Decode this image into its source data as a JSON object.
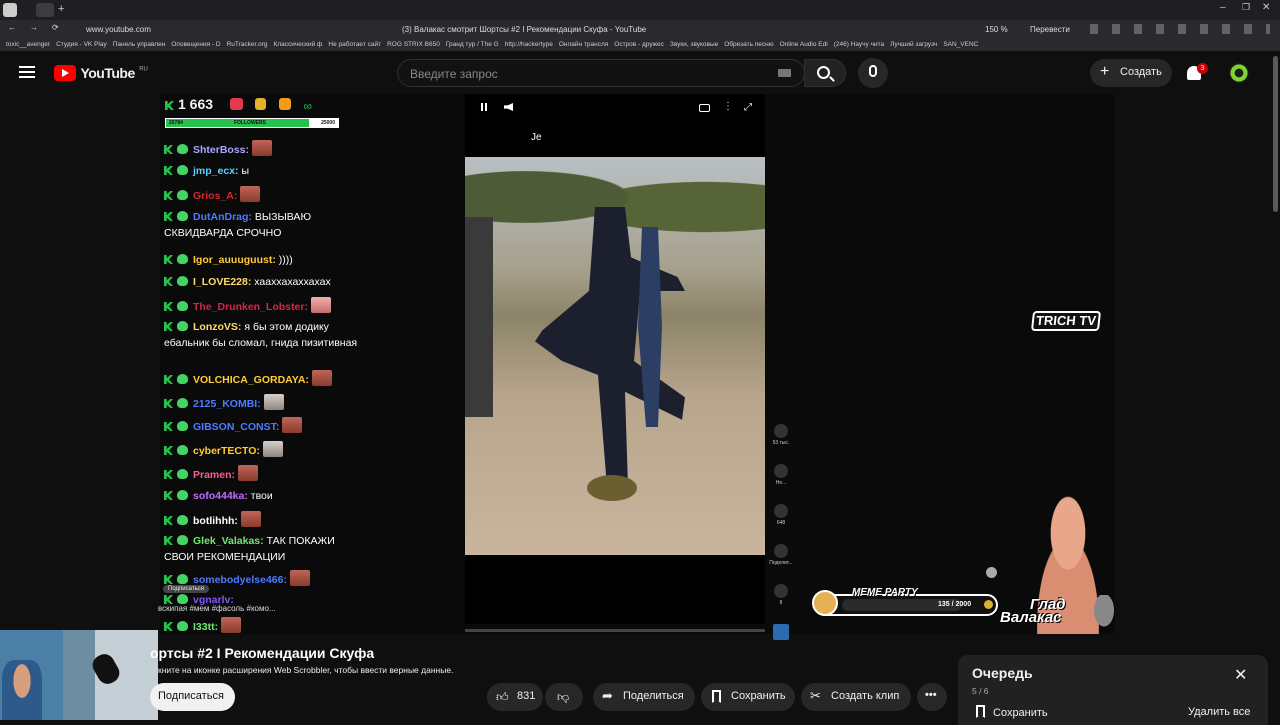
{
  "browser": {
    "url": "www.youtube.com",
    "tab_title": "(3) Валакас смотрит Шортсы #2 I Рекомендации Скуфа - YouTube",
    "zoom": "150 %",
    "translate_label": "Перевести",
    "bookmarks": [
      "toxic__avenger",
      "Студия - VK Play",
      "Панель управлен",
      "Оповещения - D",
      "RuTracker.org",
      "Классический ф",
      "Не работает сайт",
      "ROG STRIX B650",
      "Гранд тур / The G",
      "http://hackertype",
      "Онлайн трансля",
      "Остров - дружес",
      "Звуки, звуковые",
      "Обрезать песню",
      "Online Audio Edi",
      "(246) Научу чита",
      "Лучший загрузч",
      "SAN_VENC"
    ]
  },
  "youtube": {
    "logo_text": "YouTube",
    "region": "RU",
    "search_placeholder": "Введите запрос",
    "create_label": "Создать",
    "notif_count": "3"
  },
  "stream": {
    "follow_count": "1 663",
    "follow_count_shadow": "1 663",
    "followers_bar": {
      "label": "FOLLOWERS",
      "current": "20784",
      "goal": "25000",
      "progress": 0.83
    },
    "chat": [
      {
        "user": "ShterBoss:",
        "color": "#a9a7ff",
        "text": "",
        "emote": "brown"
      },
      {
        "user": "jmp_ecx:",
        "color": "#5ad1ff",
        "text": "ы",
        "emote": ""
      },
      {
        "user": "Grios_A:",
        "color": "#d62a2a",
        "text": "",
        "emote": "brown"
      },
      {
        "user": "DutAnDrag:",
        "color": "#4d7bff",
        "text": "ВЫЗЫВАЮ СКВИДВАРДА СРОЧНО",
        "emote": ""
      },
      {
        "user": "Igor_auuuguust:",
        "color": "#ffcc33",
        "text": "))))",
        "emote": ""
      },
      {
        "user": "I_LOVE228:",
        "color": "#ffdb6a",
        "text": "хааххахаххахах",
        "emote": ""
      },
      {
        "user": "The_Drunken_Lobster:",
        "color": "#d4254f",
        "text": "",
        "emote": "pink"
      },
      {
        "user": "LonzoVS:",
        "color": "#ffdb6a",
        "text": "я бы этом додику ебальник бы сломал, гнида пизитивная",
        "emote": ""
      },
      {
        "user": "VOLCHICA_GORDAYA:",
        "color": "#ffcc33",
        "text": "",
        "emote": "brown"
      },
      {
        "user": "2125_KOMBI:",
        "color": "#4d7bff",
        "text": "",
        "emote": "gray"
      },
      {
        "user": "GIBSON_CONST:",
        "color": "#4d7bff",
        "text": "",
        "emote": "brown"
      },
      {
        "user": "cyberTECTO:",
        "color": "#ffcc33",
        "text": "",
        "emote": "gray"
      },
      {
        "user": "Pramen:",
        "color": "#ff5c8a",
        "text": "",
        "emote": "brown"
      },
      {
        "user": "sofo444ka:",
        "color": "#c16cff",
        "text": "твои",
        "emote": ""
      },
      {
        "user": "botlihhh:",
        "color": "#fff",
        "text": "",
        "emote": "brown"
      },
      {
        "user": "Glek_Valakas:",
        "color": "#6ee86e",
        "text": "ТАК ПОКАЖИ СВОИ РЕКОМЕНДАЦИИ",
        "emote": ""
      },
      {
        "user": "somebodyelse466:",
        "color": "#4d7bff",
        "text": "",
        "emote": "brown"
      },
      {
        "user": "vgnarlv:",
        "color": "#7f5af0",
        "text": "",
        "emote": ""
      },
      {
        "user": "I33tt:",
        "color": "#6ee86e",
        "text": "",
        "emote": "brown"
      }
    ],
    "subscribe_tooltip": "Подписаться",
    "scrolling_line": "вскипая #мем #фасоль #комо...",
    "video_caption": "Je",
    "side_counts": [
      "53 тыс.",
      "Не...",
      "648",
      "Поделит...",
      "8"
    ],
    "watermark": "TRICH TV",
    "meme_party_label": "MEME PARTY",
    "meme_party_count": "135 / 2000",
    "glad_text_1": "Глад",
    "glad_text_2": "Валакас"
  },
  "video_info": {
    "title": "ортсы #2 I Рекомендации Скуфа",
    "scrobbler_hint": "кните на иконке расширения Web Scrobbler, чтобы ввести верные данные.",
    "subscribe_label": "Подписаться",
    "like_count": "831",
    "share_label": "Поделиться",
    "save_label": "Сохранить",
    "clip_label": "Создать клип"
  },
  "queue": {
    "title": "Очередь",
    "position": "5 / 6",
    "save_label": "Сохранить",
    "delete_all_label": "Удалить все"
  },
  "colors": {
    "yt_red": "#ff0000",
    "green_badge": "#27c24c",
    "background": "#0f0f0f"
  }
}
